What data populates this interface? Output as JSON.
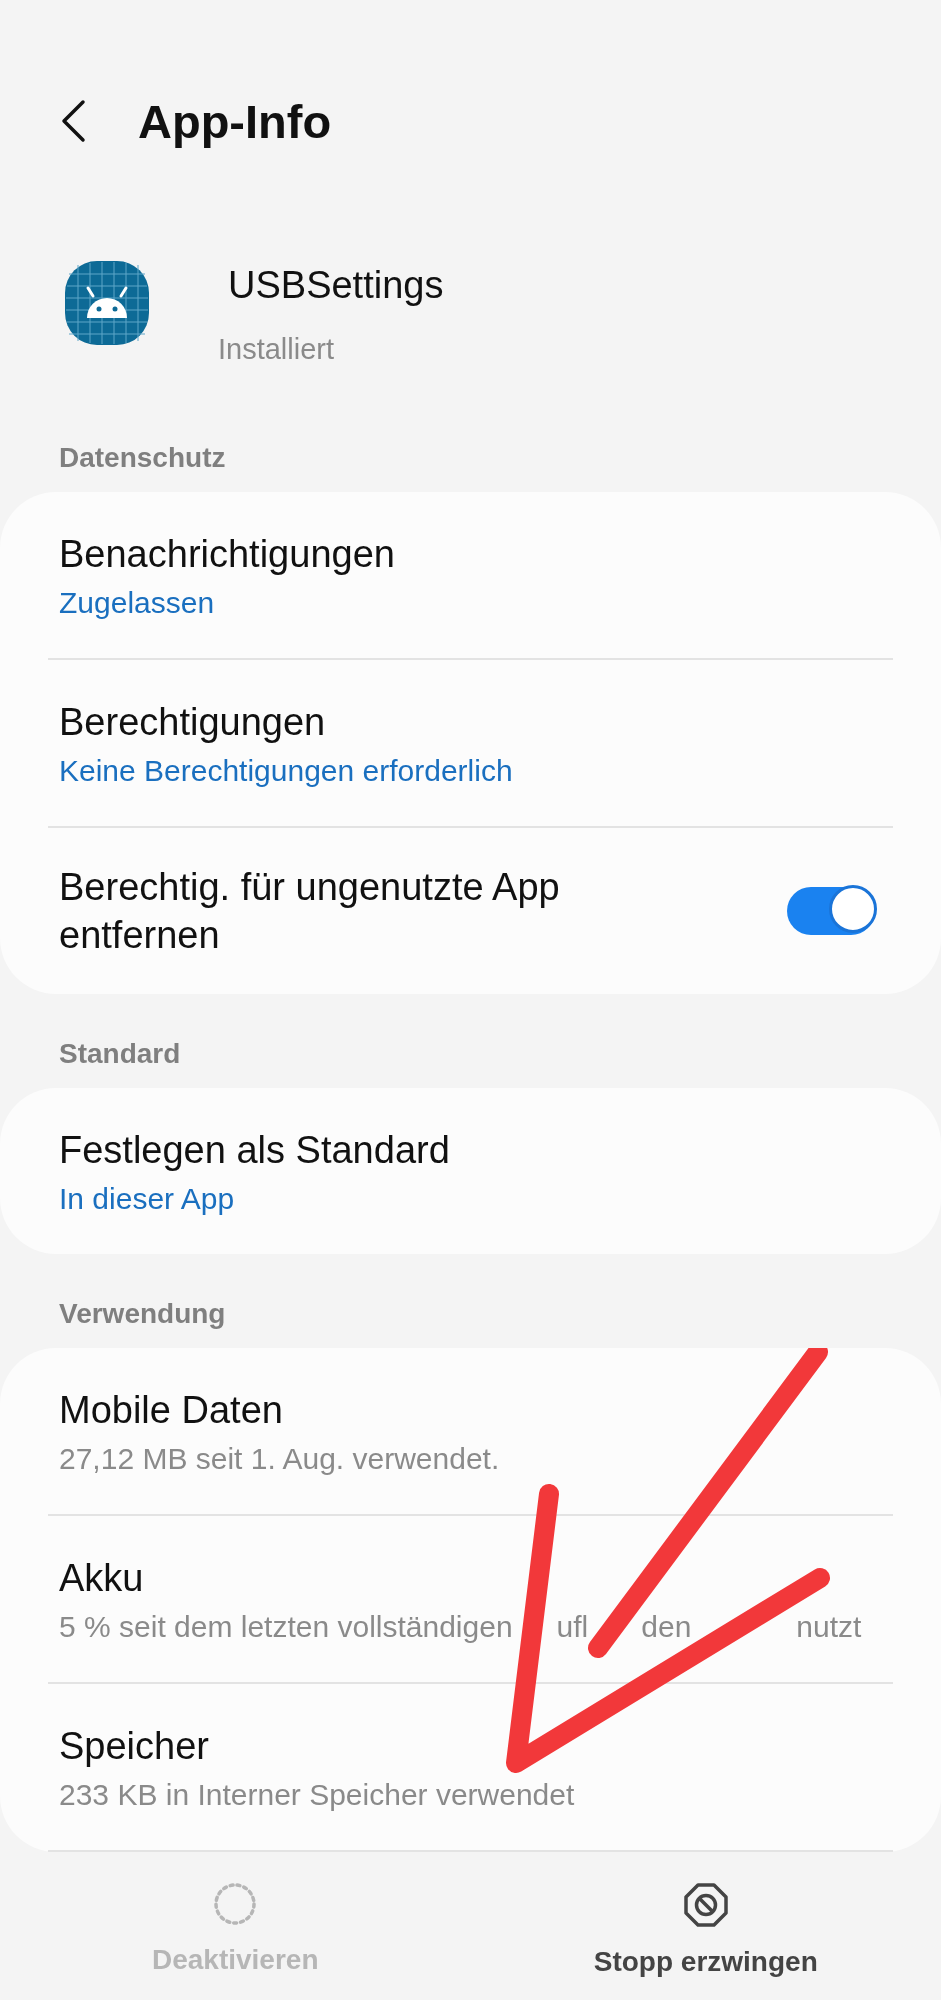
{
  "header": {
    "back_button": true,
    "title": "App-Info"
  },
  "app": {
    "name": "USBSettings",
    "status": "Installiert"
  },
  "sections": [
    {
      "title": "Datenschutz",
      "items": [
        {
          "kind": "link",
          "title": "Benachrichtigungen",
          "subtitle": "Zugelassen",
          "accent": true
        },
        {
          "kind": "link",
          "title": "Berechtigungen",
          "subtitle": "Keine Berechtigungen erforderlich",
          "accent": true
        },
        {
          "kind": "toggle",
          "title": "Berechtig. für ungenutzte App entfernen",
          "on": true
        }
      ]
    },
    {
      "title": "Standard",
      "items": [
        {
          "kind": "link",
          "title": "Festlegen als Standard",
          "subtitle": "In dieser App",
          "accent": true
        }
      ]
    },
    {
      "title": "Verwendung",
      "items": [
        {
          "kind": "link",
          "title": "Mobile Daten",
          "subtitle": "27,12 MB seit 1. Aug. verwendet.",
          "accent": false
        },
        {
          "kind": "link",
          "title": "Akku",
          "subtitle": "5 % seit dem letzten vollständigen",
          "subtitle_fragments": [
            "ufl",
            "den",
            "nutzt"
          ],
          "accent": false
        },
        {
          "kind": "link",
          "title": "Speicher",
          "subtitle": "233 KB in Interner Speicher verwendet",
          "accent": false
        }
      ]
    }
  ],
  "bottom_actions": [
    {
      "kind": "disable",
      "label": "Deaktivieren",
      "disabled": true
    },
    {
      "kind": "stop",
      "label": "Stopp erzwingen",
      "disabled": false
    }
  ],
  "annotation": {
    "kind": "arrow"
  }
}
